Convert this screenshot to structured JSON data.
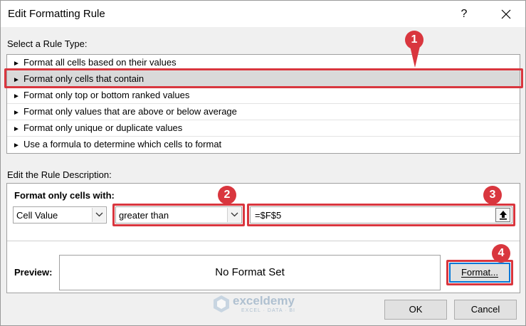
{
  "dialog": {
    "title": "Edit Formatting Rule",
    "help": "?",
    "close_icon": "close-icon"
  },
  "rule_type": {
    "label": "Select a Rule Type:",
    "items": [
      "Format all cells based on their values",
      "Format only cells that contain",
      "Format only top or bottom ranked values",
      "Format only values that are above or below average",
      "Format only unique or duplicate values",
      "Use a formula to determine which cells to format"
    ],
    "selected_index": 1
  },
  "description": {
    "label": "Edit the Rule Description:",
    "format_label": "Format only cells with:",
    "condition_type": "Cell Value",
    "operator": "greater than",
    "formula": "=$F$5",
    "preview_label": "Preview:",
    "preview_text": "No Format Set",
    "format_button": "Format..."
  },
  "buttons": {
    "ok": "OK",
    "cancel": "Cancel"
  },
  "badges": [
    "1",
    "2",
    "3",
    "4"
  ],
  "watermark": {
    "name": "exceldemy",
    "tagline": "EXCEL · DATA · BI"
  },
  "colors": {
    "highlight": "#d9363e",
    "focus": "#0078d7"
  }
}
